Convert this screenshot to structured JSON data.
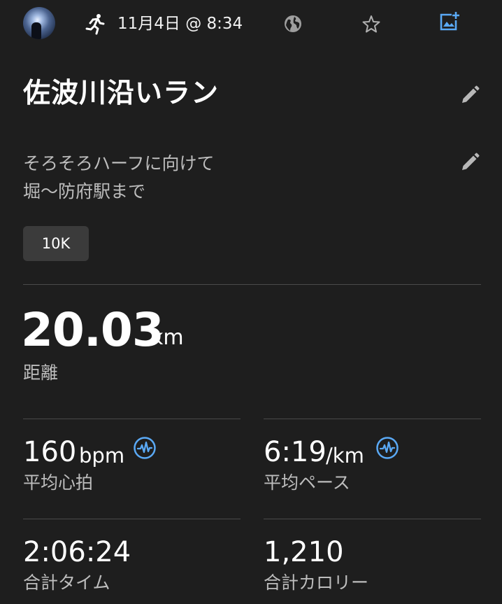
{
  "header": {
    "date_time": "11月4日 @ 8:34",
    "avatar_icon": "user-avatar",
    "activity_icon": "running-icon",
    "privacy_icon": "globe-icon",
    "favorite_icon": "star-icon",
    "add_photo_icon": "add-photo-icon"
  },
  "activity": {
    "title": "佐波川沿いラン",
    "description_lines": [
      "そろそろハーフに向けて",
      "堀〜防府駅まで"
    ],
    "tag": "10K"
  },
  "distance": {
    "value": "20.03",
    "unit": "km",
    "label": "距離"
  },
  "stats": [
    {
      "value": "160",
      "unit": "bpm",
      "label": "平均心拍",
      "icon": "heart-rate-icon"
    },
    {
      "value": "6:19",
      "unit": "/km",
      "label": "平均ペース",
      "icon": "heart-rate-icon"
    },
    {
      "value": "2:06:24",
      "unit": "",
      "label": "合計タイム"
    },
    {
      "value": "1,210",
      "unit": "",
      "label": "合計カロリー"
    }
  ],
  "colors": {
    "background": "#1e1e1e",
    "accent": "#5aa9f5",
    "label": "#bdbdbd",
    "divider": "#4a4a4a",
    "tag_bg": "#3b3b3b"
  }
}
